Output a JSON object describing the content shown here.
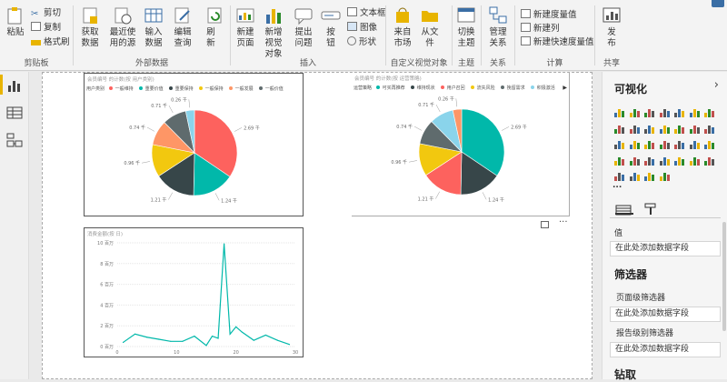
{
  "ribbon": {
    "clipboard": {
      "paste": "粘贴",
      "cut": "剪切",
      "copy": "复制",
      "format_painter": "格式刷",
      "label": "剪贴板"
    },
    "external": {
      "get_data": "获取数据",
      "recent_sources": "最近使用的源",
      "enter_data": "输入数据",
      "edit_queries": "编辑查询",
      "refresh": "刷新",
      "label": "外部数据"
    },
    "insert": {
      "new_page": "新建页面",
      "new_visual": "新增视觉对象",
      "ask_question": "提出问题",
      "buttons": "按钮",
      "textbox": "文本框",
      "image": "图像",
      "shapes": "形状",
      "label": "插入"
    },
    "custom_visuals": {
      "from_market": "来自市场",
      "from_file": "从文件",
      "label": "自定义视觉对象"
    },
    "themes": {
      "switch_theme": "切换主题",
      "label": "主题"
    },
    "relationships": {
      "manage": "管理关系",
      "label": "关系"
    },
    "calculations": {
      "new_measure": "新建度量值",
      "new_column": "新建列",
      "new_quick_measure": "新建快速度量值",
      "label": "计算"
    },
    "share": {
      "publish": "发布",
      "label": "共享"
    }
  },
  "visuals": {
    "pie1": {
      "title": "会员编号 的计数(按 用户类别)",
      "legend_title": "用户类别",
      "legend": [
        "一般维持",
        "重要价值",
        "重要保持",
        "一般保持",
        "一般发展",
        "一般价值"
      ],
      "labels": [
        "2.69 千",
        "1.24 千",
        "1.21 千",
        "0.96 千",
        "0.74 千",
        "0.71 千",
        "0.26 千"
      ]
    },
    "pie2": {
      "title": "会员编号 的计数(按 运营策略)",
      "legend_title": "运营策略",
      "legend": [
        "可买再推荐",
        "维持现状",
        "用户召回",
        "流失风险",
        "挽留需求",
        "积极激活"
      ],
      "labels": [
        "2.69 千",
        "1.24 千",
        "1.21 千",
        "0.96 千",
        "0.74 千",
        "0.71 千",
        "0.26 千"
      ]
    },
    "line": {
      "title": "消费金额(按 日)",
      "y_ticks": [
        "0 百万",
        "2 百万",
        "4 百万",
        "6 百万",
        "8 百万",
        "10 百万"
      ],
      "x_ticks": [
        "0",
        "10",
        "20",
        "30"
      ]
    }
  },
  "chart_data": [
    {
      "type": "pie",
      "title": "会员编号 的计数(按 用户类别)",
      "legend_title": "用户类别",
      "slices": [
        {
          "label": "一般维持",
          "value": 2.69,
          "color": "#fd625e"
        },
        {
          "label": "重要价值",
          "value": 1.24,
          "color": "#01b8aa"
        },
        {
          "label": "重要保持",
          "value": 1.21,
          "color": "#374649"
        },
        {
          "label": "一般保持",
          "value": 0.96,
          "color": "#f2c80f"
        },
        {
          "label": "一般发展",
          "value": 0.74,
          "color": "#fe9666"
        },
        {
          "label": "一般价值",
          "value": 0.71,
          "color": "#5f6b6d"
        },
        {
          "label": "",
          "value": 0.26,
          "color": "#8ad4eb"
        }
      ]
    },
    {
      "type": "pie",
      "title": "会员编号 的计数(按 运营策略)",
      "legend_title": "运营策略",
      "slices": [
        {
          "label": "可买再推荐",
          "value": 2.69,
          "color": "#01b8aa"
        },
        {
          "label": "维持现状",
          "value": 1.24,
          "color": "#374649"
        },
        {
          "label": "用户召回",
          "value": 1.21,
          "color": "#fd625e"
        },
        {
          "label": "流失风险",
          "value": 0.96,
          "color": "#f2c80f"
        },
        {
          "label": "挽留需求",
          "value": 0.74,
          "color": "#5f6b6d"
        },
        {
          "label": "积极激活",
          "value": 0.71,
          "color": "#8ad4eb"
        },
        {
          "label": "",
          "value": 0.26,
          "color": "#fe9666"
        }
      ]
    },
    {
      "type": "line",
      "title": "消费金额(按 日)",
      "ylabel": "",
      "xlabel": "",
      "ylim": [
        0,
        10
      ],
      "xlim": [
        0,
        30
      ],
      "y_unit": "百万",
      "color": "#01b8aa",
      "x": [
        1,
        3,
        5,
        7,
        9,
        11,
        13,
        15,
        16,
        17,
        18,
        19,
        20,
        21,
        23,
        25,
        27,
        29
      ],
      "values": [
        0.4,
        1.2,
        0.9,
        0.7,
        0.5,
        0.5,
        1.0,
        0.1,
        1.0,
        0.8,
        9.9,
        1.2,
        1.9,
        1.4,
        0.6,
        1.1,
        0.6,
        0.2
      ]
    }
  ],
  "right_panel": {
    "visualizations_title": "可视化",
    "more_visuals": "...",
    "values_label": "值",
    "add_field": "在此处添加数据字段",
    "filters_title": "筛选器",
    "page_filters": "页面级筛选器",
    "page_add_field": "在此处添加数据字段",
    "report_filters": "报告级别筛选器",
    "report_add_field": "在此处添加数据字段",
    "drillthrough_title": "钻取"
  },
  "colors": {
    "accent": "#01b8aa",
    "brand": "#f2c80f",
    "selected": "#e8b400"
  }
}
